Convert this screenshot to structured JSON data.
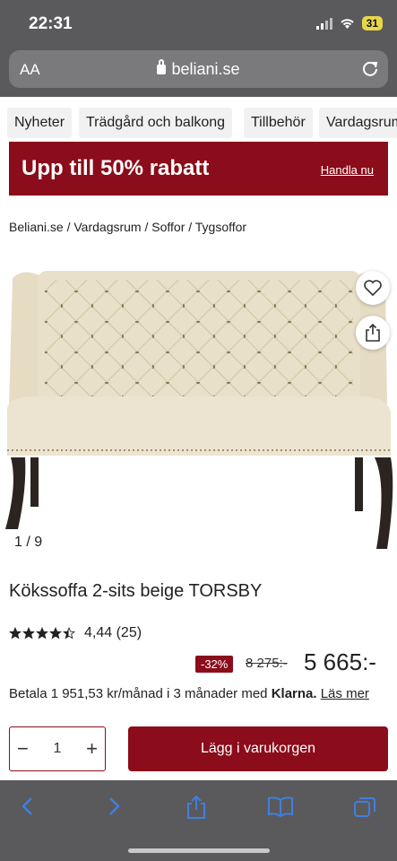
{
  "status": {
    "time": "22:31",
    "battery": "31"
  },
  "browser": {
    "aa_label": "AA",
    "url": "beliani.se"
  },
  "categories": [
    "Nyheter",
    "Trädgård och balkong",
    "Tillbehör",
    "Vardagsrum"
  ],
  "promo": {
    "title": "Upp till 50% rabatt",
    "link": "Handla nu"
  },
  "breadcrumb": "Beliani.se / Vardagsrum / Soffor / Tygsoffor",
  "gallery": {
    "counter": "1 / 9"
  },
  "product": {
    "title": "Kökssoffa 2-sits beige TORSBY",
    "rating_value": 4.44,
    "rating_text": "4,44 (25)",
    "discount": "-32%",
    "old_price": "8 275:-",
    "price": "5 665:-",
    "klarna_prefix": "Betala 1 951,53 kr/månad i 3 månader med ",
    "klarna_brand": "Klarna.",
    "klarna_link": "Läs mer"
  },
  "cart": {
    "quantity": "1",
    "minus": "−",
    "plus": "+",
    "add_label": "Lägg i varukorgen"
  },
  "colors": {
    "brand": "#8b0c1a",
    "chrome": "#5a5a5c",
    "toolbar_icon": "#3f7fe0"
  },
  "icons": [
    "heart-icon",
    "share-icon",
    "back-icon",
    "forward-icon",
    "bookmarks-icon",
    "tabs-icon",
    "reload-icon",
    "lock-icon",
    "wifi-icon",
    "star-icon"
  ]
}
